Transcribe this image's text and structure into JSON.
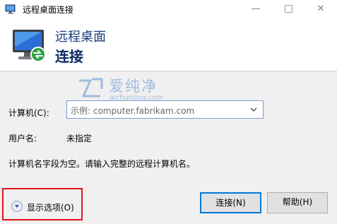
{
  "window": {
    "title": "远程桌面连接",
    "minimize_glyph": "—",
    "close_glyph": "✕"
  },
  "header": {
    "line1": "远程桌面",
    "line2": "连接"
  },
  "watermark": {
    "cn": "爱纯净",
    "en": "aichunjing.com"
  },
  "form": {
    "computer_label": "计算机(C):",
    "computer_placeholder": "示例: computer.fabrikam.com",
    "user_label": "用户名:",
    "user_value": "未指定",
    "info_text": "计算机名字段为空。请输入完整的远程计算机名。"
  },
  "footer": {
    "show_options_label": "显示选项(O)",
    "connect_label": "连接(N)",
    "help_label": "帮助(H)"
  },
  "colors": {
    "title_blue": "#1a3e7a",
    "watermark_blue": "#8cb0dc",
    "highlight_red": "#e3131b",
    "default_button_border": "#0078d7"
  }
}
